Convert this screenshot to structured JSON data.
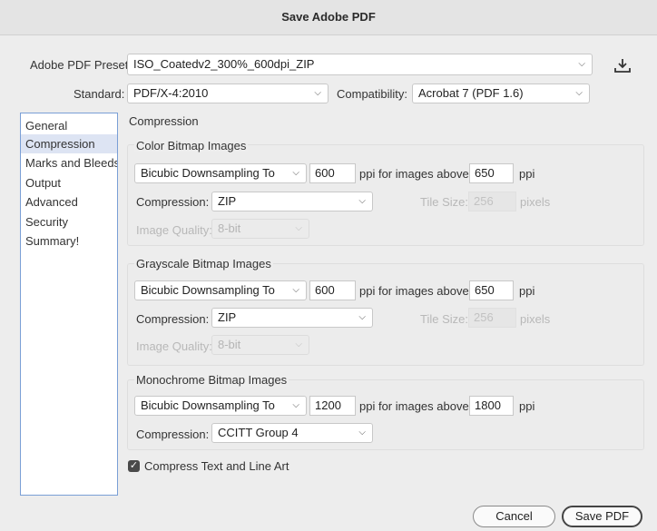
{
  "window": {
    "title": "Save Adobe PDF"
  },
  "preset": {
    "label": "Adobe PDF Preset:",
    "value": "ISO_Coatedv2_300%_600dpi_ZIP"
  },
  "standard": {
    "label": "Standard:",
    "value": "PDF/X-4:2010"
  },
  "compatibility": {
    "label": "Compatibility:",
    "value": "Acrobat 7 (PDF 1.6)"
  },
  "sidebar": {
    "items": [
      {
        "label": "General"
      },
      {
        "label": "Compression"
      },
      {
        "label": "Marks and Bleeds"
      },
      {
        "label": "Output"
      },
      {
        "label": "Advanced"
      },
      {
        "label": "Security"
      },
      {
        "label": "Summary!"
      }
    ],
    "selected": "Compression"
  },
  "panel": {
    "title": "Compression"
  },
  "color": {
    "title": "Color Bitmap Images",
    "sampling": "Bicubic Downsampling To",
    "ppi": "600",
    "above_label": "ppi for images above",
    "above": "650",
    "ppi_unit": "ppi",
    "compression_label": "Compression:",
    "compression": "ZIP",
    "tile_label": "Tile Size:",
    "tile": "256",
    "tile_unit": "pixels",
    "quality_label": "Image Quality:",
    "quality": "8-bit"
  },
  "grayscale": {
    "title": "Grayscale Bitmap Images",
    "sampling": "Bicubic Downsampling To",
    "ppi": "600",
    "above_label": "ppi for images above",
    "above": "650",
    "ppi_unit": "ppi",
    "compression_label": "Compression:",
    "compression": "ZIP",
    "tile_label": "Tile Size:",
    "tile": "256",
    "tile_unit": "pixels",
    "quality_label": "Image Quality:",
    "quality": "8-bit"
  },
  "mono": {
    "title": "Monochrome Bitmap Images",
    "sampling": "Bicubic Downsampling To",
    "ppi": "1200",
    "above_label": "ppi for images above",
    "above": "1800",
    "ppi_unit": "ppi",
    "compression_label": "Compression:",
    "compression": "CCITT Group 4"
  },
  "compress_text": {
    "label": "Compress Text and Line Art",
    "checked": true
  },
  "buttons": {
    "cancel": "Cancel",
    "save": "Save PDF"
  },
  "icons": {
    "preset_save": "save-preset-icon",
    "chevron": "chevron-down-icon",
    "check": "checkmark-icon"
  }
}
